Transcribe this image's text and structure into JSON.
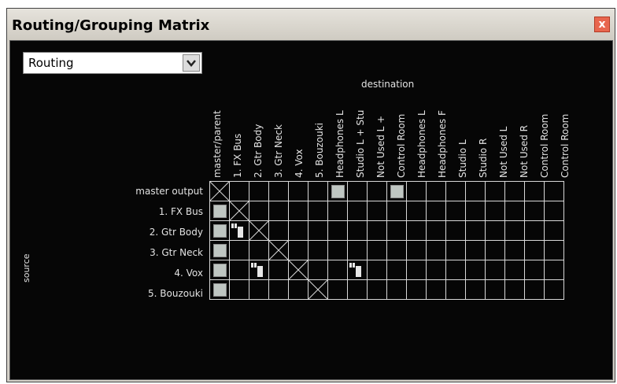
{
  "window": {
    "title": "Routing/Grouping Matrix",
    "close_glyph": "x"
  },
  "mode_select": {
    "value": "Routing",
    "dropdown_icon": "chevron-down-icon"
  },
  "axis": {
    "destination": "destination",
    "source": "source"
  },
  "columns": [
    "master/parent",
    "1. FX Bus",
    "2. Gtr Body",
    "3. Gtr Neck",
    "4. Vox",
    "5. Bouzouki",
    "Headphones L",
    "Studio L + Stu",
    "Not Used L +",
    "Control Room",
    "Headphones L",
    "Headphones F",
    "Studio L",
    "Studio R",
    "Not Used L",
    "Not Used R",
    "Control Room",
    "Control Room"
  ],
  "rows": [
    "master output",
    "1. FX Bus",
    "2. Gtr Body",
    "3. Gtr Neck",
    "4. Vox",
    "5. Bouzouki"
  ],
  "matrix": [
    [
      "x",
      "",
      "",
      "",
      "",
      "",
      "on",
      "",
      "",
      "on",
      "",
      "",
      "",
      "",
      "",
      "",
      "",
      ""
    ],
    [
      "on",
      "x",
      "",
      "",
      "",
      "",
      "",
      "",
      "",
      "",
      "",
      "",
      "",
      "",
      "",
      "",
      "",
      ""
    ],
    [
      "on",
      "partial",
      "x",
      "",
      "",
      "",
      "",
      "",
      "",
      "",
      "",
      "",
      "",
      "",
      "",
      "",
      "",
      ""
    ],
    [
      "on",
      "",
      "",
      "x",
      "",
      "",
      "",
      "",
      "",
      "",
      "",
      "",
      "",
      "",
      "",
      "",
      "",
      ""
    ],
    [
      "on",
      "",
      "partial",
      "",
      "x",
      "",
      "",
      "partial",
      "",
      "",
      "",
      "",
      "",
      "",
      "",
      "",
      "",
      ""
    ],
    [
      "on",
      "",
      "",
      "",
      "",
      "x",
      "",
      "",
      "",
      "",
      "",
      "",
      "",
      "",
      "",
      "",
      "",
      ""
    ]
  ],
  "colors": {
    "background": "#060606",
    "grid_line": "#d8d8d8",
    "route_fill": "#bfc6c2",
    "close_button": "#e8664e"
  }
}
